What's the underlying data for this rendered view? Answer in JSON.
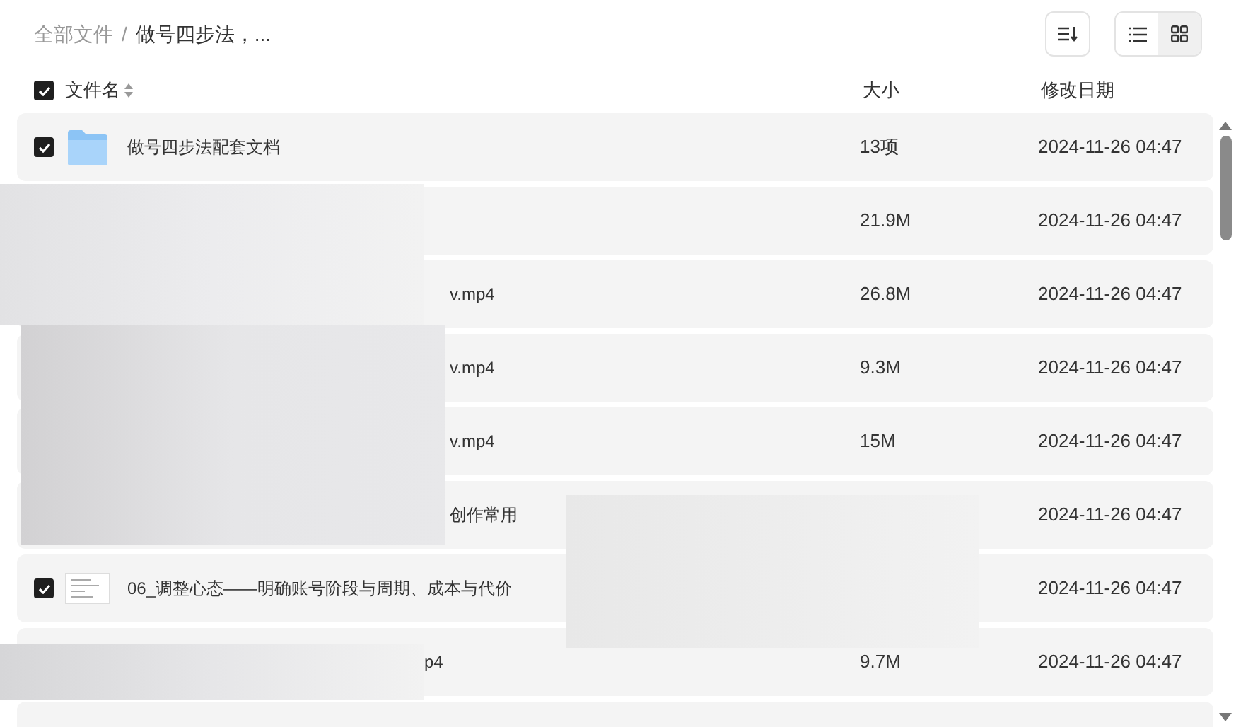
{
  "breadcrumb": [
    {
      "label": "全部文件",
      "current": false
    },
    {
      "label": "做号四步法，...",
      "current": true
    }
  ],
  "separator": "/",
  "view_toggle": [
    {
      "kind": "list",
      "selected": true
    },
    {
      "kind": "grid",
      "selected": false
    }
  ],
  "columns": {
    "select_all": {
      "checked": true
    },
    "name": "文件名",
    "size": "大小",
    "modified": "修改日期"
  },
  "rows": [
    {
      "kind": "folder",
      "checked": true,
      "name": "做号四步法配套文档",
      "size": "13项",
      "modified": "2024-11-26 04:47"
    },
    {
      "kind": "hidden",
      "size": "21.9M",
      "modified": "2024-11-26 04:47"
    },
    {
      "kind": "hidden",
      "name": "v.mp4",
      "size": "26.8M",
      "modified": "2024-11-26 04:47"
    },
    {
      "kind": "hidden",
      "name": "v.mp4",
      "size": "9.3M",
      "modified": "2024-11-26 04:47"
    },
    {
      "kind": "hidden",
      "name": "v.mp4",
      "size": "15M",
      "modified": "2024-11-26 04:47"
    },
    {
      "kind": "hidden",
      "name": "创作常用",
      "modified": "2024-11-26 04:47"
    },
    {
      "kind": "document",
      "checked": true,
      "name": "06_调整心态——明确账号阶段与周期、成本与代价",
      "modified": "2024-11-26 04:47"
    },
    {
      "kind": "hidden",
      "name": "p4",
      "size": "9.7M",
      "modified": "2024-11-26 04:47"
    },
    {
      "kind": "hidden"
    }
  ]
}
